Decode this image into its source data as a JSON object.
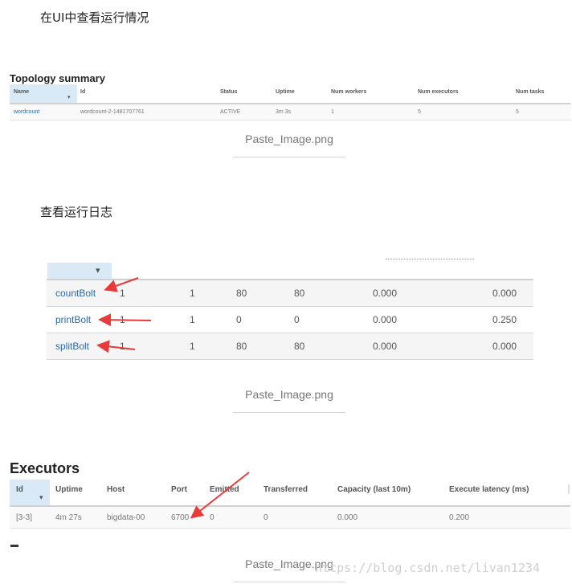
{
  "headings": {
    "ui_view": "在UI中查看运行情况",
    "log_view": "查看运行日志"
  },
  "topology": {
    "title": "Topology summary",
    "columns": [
      "Name",
      "Id",
      "Status",
      "Uptime",
      "Num workers",
      "Num executors",
      "Num tasks"
    ],
    "row": {
      "name": "wordcount",
      "id": "wordcount-2-1481707761",
      "status": "ACTIVE",
      "uptime": "3m 3s",
      "num_workers": "1",
      "num_executors": "5",
      "num_tasks": "5"
    }
  },
  "captions": {
    "c1": "Paste_Image.png",
    "c2": "Paste_Image.png",
    "c3": "Paste_Image.png"
  },
  "bolts": {
    "rows": [
      {
        "name": "countBolt",
        "c1": "1",
        "c2": "1",
        "c3": "80",
        "c4": "80",
        "c5": "0.000",
        "c6": "0.000"
      },
      {
        "name": "printBolt",
        "c1": "1",
        "c2": "1",
        "c3": "0",
        "c4": "0",
        "c5": "0.000",
        "c6": "0.250"
      },
      {
        "name": "splitBolt",
        "c1": "1",
        "c2": "1",
        "c3": "80",
        "c4": "80",
        "c5": "0.000",
        "c6": "0.000"
      }
    ]
  },
  "executors": {
    "title": "Executors",
    "columns": [
      "Id",
      "Uptime",
      "Host",
      "Port",
      "Emitted",
      "Transferred",
      "Capacity (last 10m)",
      "Execute latency (ms)"
    ],
    "row": {
      "id": "[3-3]",
      "uptime": "4m 27s",
      "host": "bigdata-00",
      "port": "6700",
      "emitted": "0",
      "transferred": "0",
      "capacity": "0.000",
      "latency": "0.200"
    }
  },
  "watermark": "https://blog.csdn.net/livan1234",
  "colors": {
    "link": "#2a6aad",
    "arrow": "#e83a3a",
    "sorted_header": "#d9e9f6"
  }
}
